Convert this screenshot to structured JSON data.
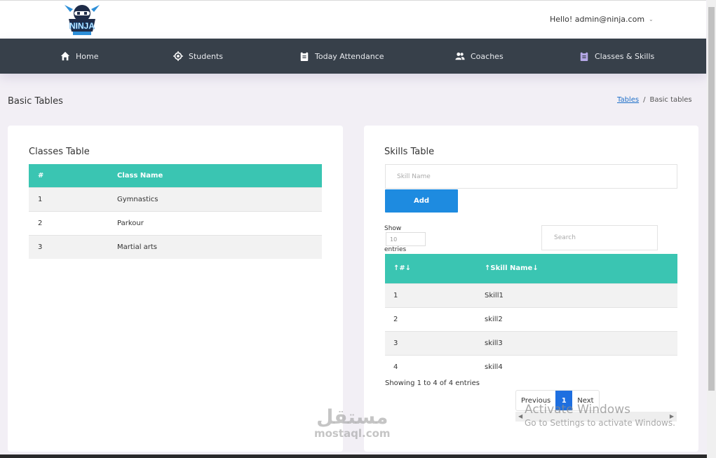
{
  "header": {
    "logo_text": "NINJA",
    "user_greeting": "Hello! admin@ninja.com"
  },
  "nav": {
    "items": [
      {
        "label": "Home",
        "icon": "home-icon"
      },
      {
        "label": "Students",
        "icon": "target-icon"
      },
      {
        "label": "Today Attendance",
        "icon": "clipboard-icon"
      },
      {
        "label": "Coaches",
        "icon": "users-icon"
      },
      {
        "label": "Classes & Skills",
        "icon": "clipboard-icon",
        "active": true
      }
    ],
    "active_color": "#b6a8e8"
  },
  "page": {
    "title": "Basic Tables",
    "breadcrumb": [
      "Tables",
      "/",
      "Basic tables"
    ]
  },
  "classes_card": {
    "title": "Classes Table",
    "columns": [
      "#",
      "Class Name"
    ],
    "rows": [
      [
        "1",
        "Gymnastics"
      ],
      [
        "2",
        "Parkour"
      ],
      [
        "3",
        "Martial arts"
      ]
    ]
  },
  "skills_card": {
    "title": "Skills Table",
    "input_placeholder": "Skill Name",
    "add_label": "Add",
    "show_label": "Show",
    "entries_value": "10",
    "entries_label": "entries",
    "search_placeholder": "Search",
    "columns": [
      "↑#↓",
      "↑Skill Name↓"
    ],
    "rows": [
      [
        "1",
        "Skill1"
      ],
      [
        "2",
        "skill2"
      ],
      [
        "3",
        "skill3"
      ],
      [
        "4",
        "skill4"
      ]
    ],
    "showing_text": "Showing 1 to 4 of 4 entries",
    "pager": {
      "previous": "Previous",
      "current": "1",
      "next": "Next"
    }
  },
  "overlay": {
    "activate_title": "Activate Windows",
    "activate_sub": "Go to Settings to activate Windows.",
    "watermark_ar": "مستقل",
    "watermark_lat": "mostaql.com"
  },
  "colors": {
    "nav_bg": "#37404a",
    "table_header": "#3ac5b2",
    "button": "#1e8be0",
    "page_bg": "#f2eff5"
  }
}
